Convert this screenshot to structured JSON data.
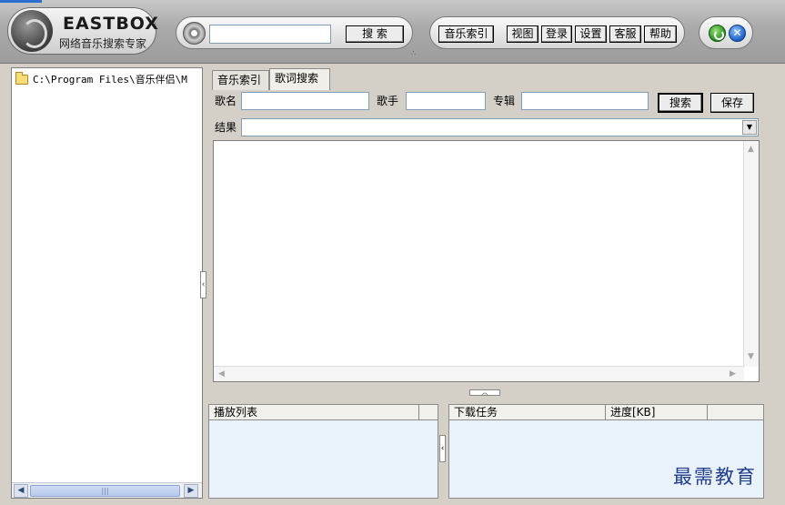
{
  "app": {
    "brand": "EASTBOX",
    "subtitle": "网络音乐搜索专家",
    "accent_color": "#2c6fd1"
  },
  "top_search": {
    "value": "",
    "button_label": "搜 索"
  },
  "nav": {
    "music_index": "音乐索引",
    "view": "视图",
    "login": "登录",
    "settings": "设置",
    "support": "客服",
    "help": "帮助"
  },
  "window_controls": {
    "minimize_icon": "green-minimize-icon",
    "close_icon": "blue-close-icon",
    "close_glyph": "✕"
  },
  "folder_tree": {
    "path": "C:\\Program Files\\音乐伴侣\\M"
  },
  "tabs": [
    {
      "label": "音乐索引",
      "active": false
    },
    {
      "label": "歌词搜索",
      "active": true
    }
  ],
  "lyrics_search": {
    "song_label": "歌名",
    "song_value": "",
    "artist_label": "歌手",
    "artist_value": "",
    "album_label": "专辑",
    "album_value": "",
    "search_button": "搜索",
    "save_button": "保存",
    "result_label": "结果",
    "result_value": ""
  },
  "playlist": {
    "header": "播放列表"
  },
  "downloads": {
    "task_header": "下载任务",
    "progress_header": "进度[KB]"
  },
  "watermark": "最需教育"
}
